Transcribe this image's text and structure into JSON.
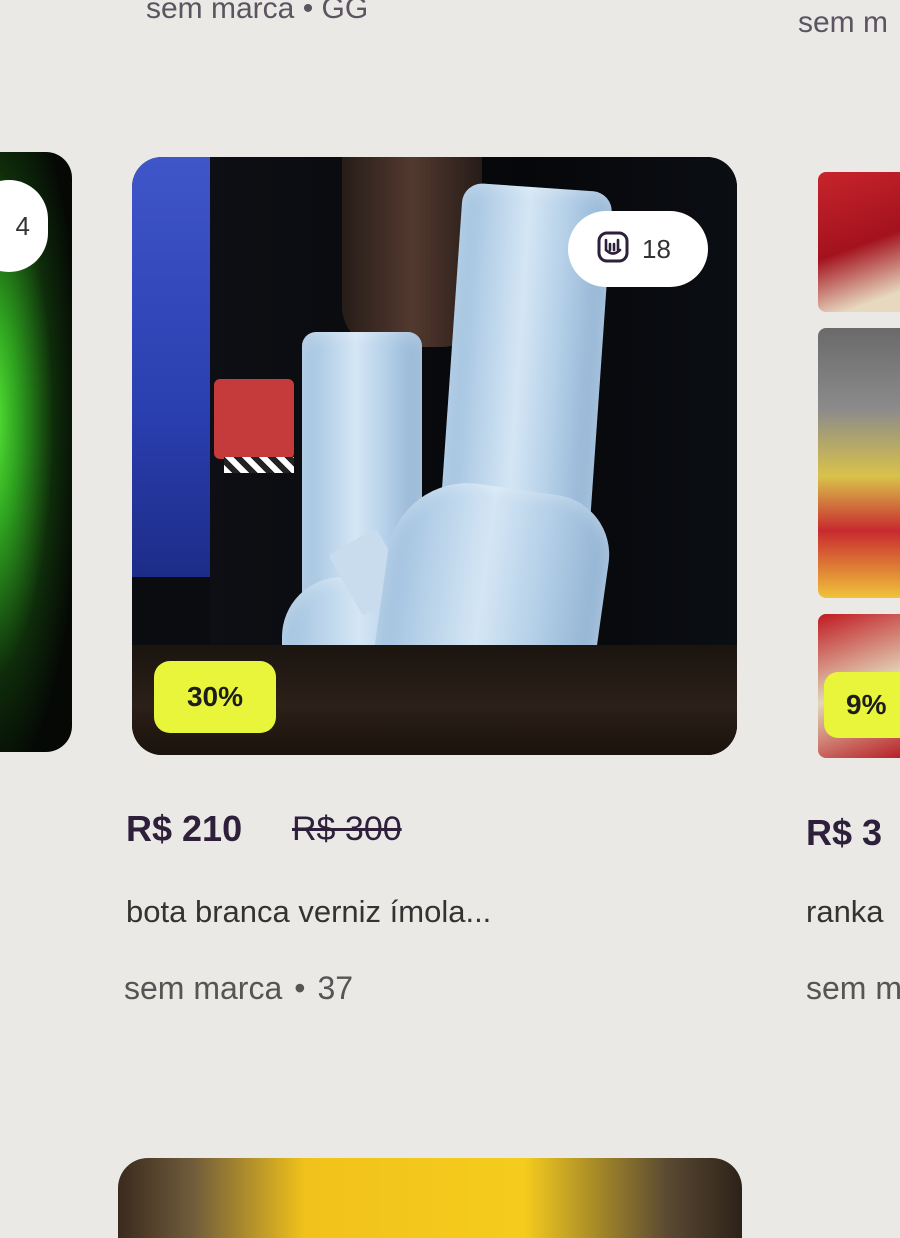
{
  "top": {
    "left_meta": "sem marca  •  GG",
    "right_meta": "sem m"
  },
  "left_card": {
    "likes": "4"
  },
  "main_card": {
    "likes": "18",
    "likes_icon": "rock-hand-icon",
    "discount": "30%",
    "price": "R$ 210",
    "old_price": "R$ 300",
    "title": "bota branca verniz ímola...",
    "brand": "sem marca",
    "size": "37"
  },
  "right_card": {
    "discount": "9%",
    "price": "R$ 3",
    "title": "ranka",
    "meta": "sem m"
  },
  "colors": {
    "discount_badge": "#e9f53a",
    "price_text": "#2e1f3a",
    "background": "#ebe9e6"
  }
}
